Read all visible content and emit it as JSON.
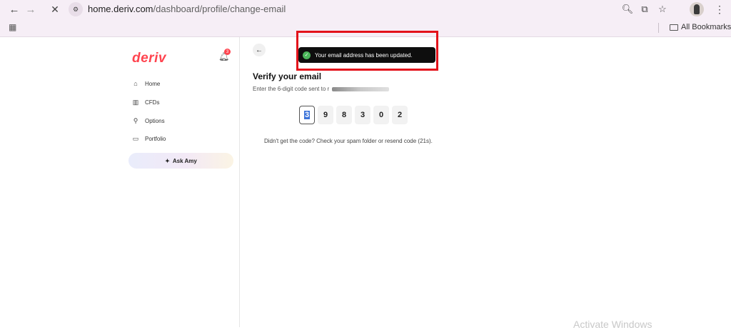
{
  "browser": {
    "url_host": "home.deriv.com",
    "url_path": "/dashboard/profile/change-email",
    "bookmarks_label": "All Bookmarks"
  },
  "sidebar": {
    "logo": "deriv",
    "notification_count": "3",
    "items": [
      {
        "label": "Home",
        "icon": "home-icon"
      },
      {
        "label": "CFDs",
        "icon": "chart-icon"
      },
      {
        "label": "Options",
        "icon": "options-icon"
      },
      {
        "label": "Portfolio",
        "icon": "portfolio-icon"
      }
    ],
    "ask_amy": "Ask Amy"
  },
  "main": {
    "heading": "Verify your email",
    "subtext": "Enter the 6-digit code sent to r",
    "code_digits": [
      "3",
      "9",
      "8",
      "3",
      "0",
      "2"
    ],
    "resend_text": "Didn't get the code? Check your spam folder or resend code (21s)."
  },
  "toast": {
    "message": "Your email address has been updated."
  },
  "watermark": "Activate Windows",
  "colors": {
    "brand": "#ff444f",
    "toast_bg": "#0e0e0e",
    "success": "#4bb65a",
    "highlight_frame": "#e3131b"
  }
}
